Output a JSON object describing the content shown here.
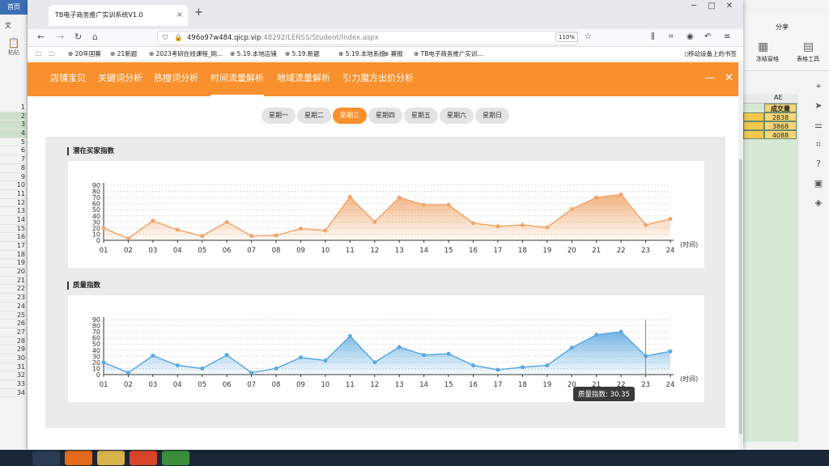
{
  "taskbar_top": {
    "tab_label": "首页"
  },
  "spreadsheet": {
    "menu_label": "文",
    "paste_label": "粘贴",
    "row_numbers": [
      "1",
      "2",
      "3",
      "4",
      "5",
      "6",
      "7",
      "8",
      "9",
      "10",
      "11",
      "12",
      "13",
      "14",
      "15",
      "16",
      "17",
      "18",
      "19",
      "20",
      "21",
      "22",
      "23",
      "24",
      "25",
      "26",
      "27",
      "28",
      "29",
      "30",
      "31",
      "32",
      "33",
      "34"
    ],
    "column_header": "AE",
    "column_title": "成交量",
    "values": [
      "2838",
      "3868",
      "4088"
    ],
    "ribbon_share": "分享",
    "ribbon_freeze": "冻结窗格",
    "ribbon_tables": "表格工具"
  },
  "browser": {
    "tab_title": "TB电子商务推广实训系统V1.0",
    "url_host": "496o97w484.qicp.vip",
    "url_rest": ":48292/LENSS/Student/Index.aspx",
    "zoom": "110%",
    "bookmarks": [
      "20年国赛",
      "21新题",
      "2023考研在线课程_网...",
      "5.19.本地店铺",
      "5.19.新题",
      "5.19.本地系统",
      "赛报",
      "TB电子商务推广实训..."
    ],
    "mobile_bookmarks": "移动设备上的书签"
  },
  "nav": {
    "items": [
      "店铺宝贝",
      "关键词分析",
      "热搜词分析",
      "时间流量解析",
      "地域流量解析",
      "引力魔方出价分析"
    ],
    "active_index": 3
  },
  "days": {
    "items": [
      "星期一",
      "星期二",
      "星期三",
      "星期四",
      "星期五",
      "星期六",
      "星期日"
    ],
    "active_index": 2
  },
  "chart_titles": [
    "潜在买家指数",
    "质量指数"
  ],
  "tooltip": "质量指数: 30.35",
  "x_unit": "(时间)",
  "colors": {
    "accent": "#f7902d",
    "buyer_line": "#f0a66a",
    "quality_line": "#5aa8e0"
  },
  "chart_data": [
    {
      "type": "area",
      "title": "潜在买家指数",
      "x": [
        "01",
        "02",
        "03",
        "04",
        "05",
        "06",
        "07",
        "08",
        "09",
        "10",
        "11",
        "12",
        "13",
        "14",
        "15",
        "16",
        "17",
        "18",
        "19",
        "20",
        "21",
        "22",
        "23",
        "24"
      ],
      "yticks": [
        0,
        10,
        20,
        30,
        40,
        50,
        60,
        70,
        80,
        90
      ],
      "ylim": [
        0,
        90
      ],
      "xlabel": "(时间)",
      "series": [
        {
          "values": [
            20,
            3,
            32,
            17,
            7,
            30,
            7,
            8,
            19,
            16,
            71,
            30,
            70,
            58,
            58,
            28,
            23,
            25,
            21,
            51,
            70,
            75,
            25,
            35
          ]
        }
      ]
    },
    {
      "type": "area",
      "title": "质量指数",
      "x": [
        "01",
        "02",
        "03",
        "04",
        "05",
        "06",
        "07",
        "08",
        "09",
        "10",
        "11",
        "12",
        "13",
        "14",
        "15",
        "16",
        "17",
        "18",
        "19",
        "20",
        "21",
        "22",
        "23",
        "24"
      ],
      "yticks": [
        0,
        10,
        20,
        30,
        40,
        50,
        60,
        70,
        80,
        90
      ],
      "ylim": [
        0,
        90
      ],
      "xlabel": "(时间)",
      "series": [
        {
          "values": [
            20,
            3,
            31,
            15,
            10,
            32,
            3,
            10,
            28,
            23,
            63,
            20,
            45,
            32,
            34,
            15,
            8,
            12,
            15,
            44,
            65,
            70,
            30.35,
            38
          ]
        }
      ],
      "highlight_index": 22
    }
  ]
}
